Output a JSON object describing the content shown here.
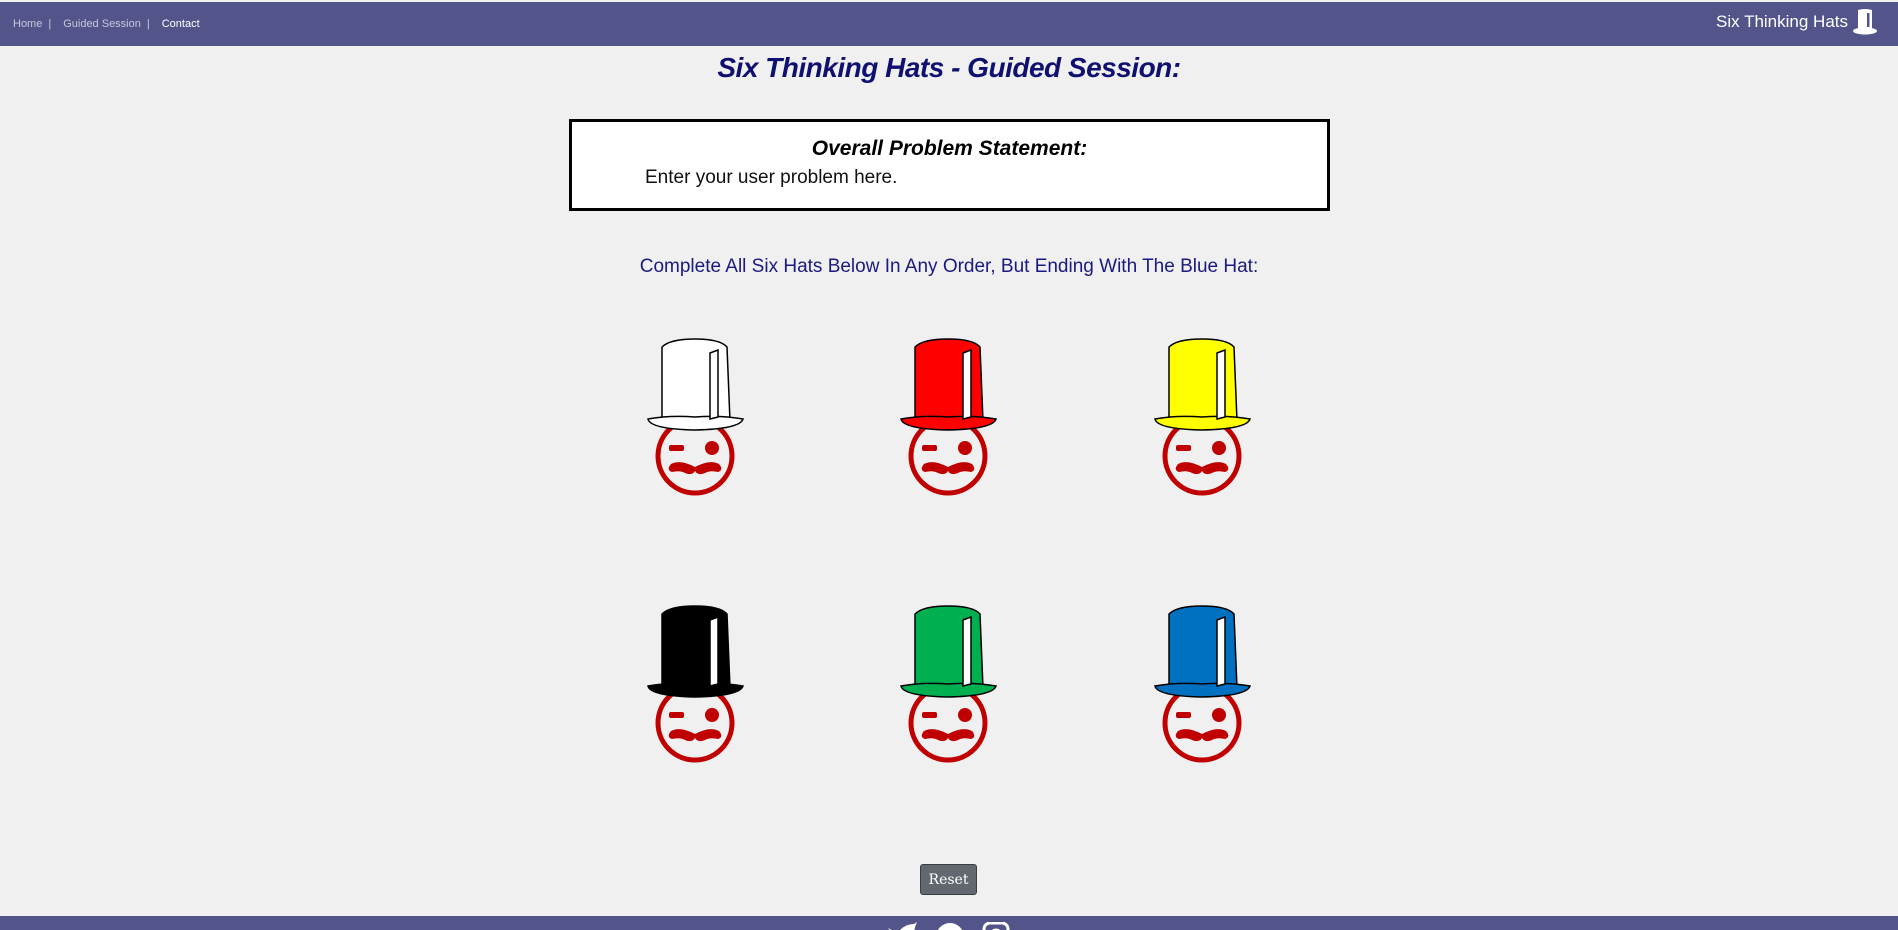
{
  "nav": {
    "links": [
      {
        "label": "Home"
      },
      {
        "label": "Guided Session"
      },
      {
        "label": "Contact"
      }
    ],
    "separator": "|",
    "brand": "Six Thinking Hats"
  },
  "page": {
    "title": "Six Thinking Hats - Guided Session:"
  },
  "problem": {
    "heading": "Overall Problem Statement:",
    "text": "Enter your user problem here."
  },
  "instructions": "Complete All Six Hats Below In Any Order, But Ending With The Blue Hat:",
  "hats": [
    {
      "color_name": "white",
      "color": "#ffffff"
    },
    {
      "color_name": "red",
      "color": "#ff0000"
    },
    {
      "color_name": "yellow",
      "color": "#ffff00"
    },
    {
      "color_name": "black",
      "color": "#000000"
    },
    {
      "color_name": "green",
      "color": "#00b050"
    },
    {
      "color_name": "blue",
      "color": "#0070c0"
    }
  ],
  "face_color": "#c00000",
  "reset_label": "Reset",
  "footer_icons": [
    "twitter-icon",
    "pinterest-icon",
    "instagram-icon"
  ],
  "colors": {
    "navbar": "#53558a",
    "title": "#101070",
    "background": "#f0f0f0"
  }
}
